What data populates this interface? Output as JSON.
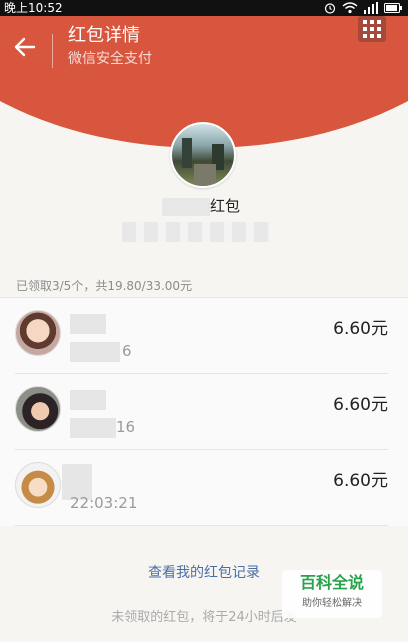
{
  "status_bar": {
    "time": "晚上10:52",
    "icons": [
      "alarm-icon",
      "wifi-icon",
      "signal-icon",
      "battery-icon"
    ]
  },
  "header": {
    "title": "红包详情",
    "subtitle": "微信安全支付",
    "back_icon": "back-arrow-icon",
    "menu_icon": "grid-menu-icon",
    "colors": {
      "banner": "#d8553e"
    }
  },
  "sender": {
    "name_suffix": "红包"
  },
  "summary": "已领取3/5个，共19.80/33.00元",
  "claims": [
    {
      "time": "6",
      "amount": "6.60元"
    },
    {
      "time": "16",
      "amount": "6.60元"
    },
    {
      "time": "22:03:21",
      "amount": "6.60元"
    }
  ],
  "records_link": "查看我的红包记录",
  "footer_note": "未领取的红包，将于24小时后发",
  "watermark": {
    "title": "百科全说",
    "subtitle": "助你轻松解决"
  }
}
